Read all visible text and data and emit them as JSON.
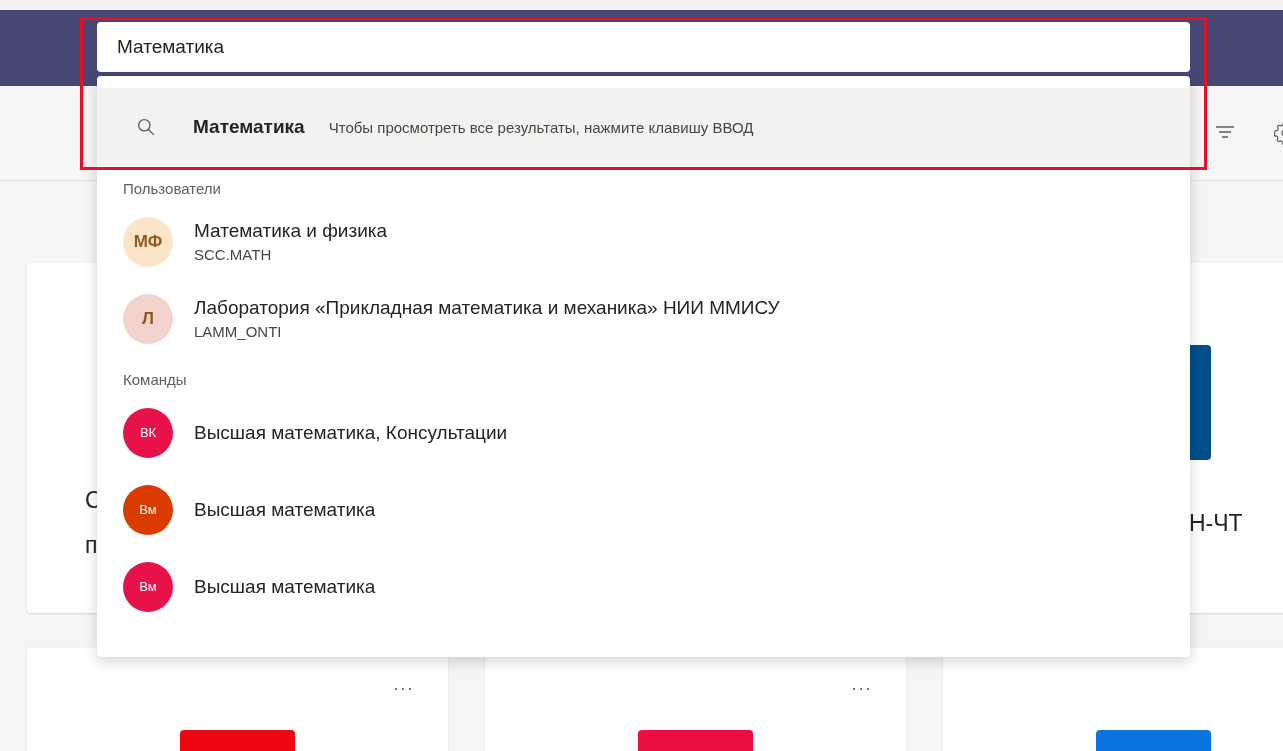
{
  "search": {
    "value": "Математика"
  },
  "dropdown": {
    "suggestion": {
      "query": "Математика",
      "hint": "Чтобы просмотреть все результаты, нажмите клавишу ВВОД",
      "selected": true
    },
    "sections": [
      {
        "heading": "Пользователи",
        "items": [
          {
            "initials": "МФ",
            "name": "Математика и физика",
            "subtitle": "SCC.MATH",
            "color": "#fce4c9"
          },
          {
            "initials": "Л",
            "name": "Лаборатория «Прикладная математика и механика» НИИ ММИСУ",
            "subtitle": "LAMM_ONTI",
            "color": "#f1d3cc"
          }
        ]
      },
      {
        "heading": "Команды",
        "items": [
          {
            "initials": "ВК",
            "name": "Высшая математика, Консультации",
            "color": "#e8124a"
          },
          {
            "initials": "Вм",
            "name": "Высшая математика",
            "color": "#da3b01"
          },
          {
            "initials": "Вм",
            "name": "Высшая математика",
            "color": "#e8124a"
          }
        ]
      }
    ]
  },
  "cards": [
    {
      "title_lines": [
        "С",
        "п"
      ]
    },
    {
      "color": "#004e8c",
      "title_lines": [
        "Н-ЧТ"
      ]
    },
    {
      "menu": "···",
      "color": "#ee0710"
    },
    {
      "menu": "···",
      "color": "#ea0f3f"
    },
    {
      "color": "#0a73e0"
    }
  ]
}
